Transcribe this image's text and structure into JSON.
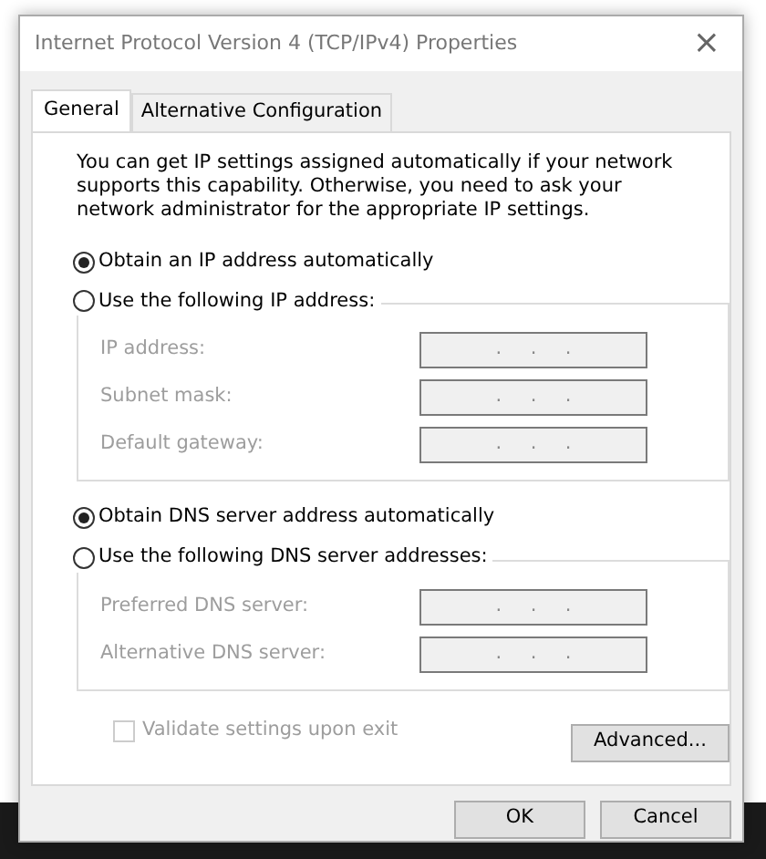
{
  "window": {
    "title": "Internet Protocol Version 4 (TCP/IPv4) Properties",
    "close": "×"
  },
  "tabs": [
    {
      "label": "General",
      "selected": true
    },
    {
      "label": "Alternative Configuration",
      "selected": false
    }
  ],
  "intro": "You can get IP settings assigned automatically if your network supports this capability. Otherwise, you need to ask your network administrator for the appropriate IP settings.",
  "groups": [
    {
      "auto_option": {
        "label": "Obtain an IP address automatically",
        "selected": true
      },
      "manual_option": {
        "label": "Use the following IP address:",
        "selected": false
      },
      "fields": [
        {
          "label": "IP address:",
          "separators": [
            ".",
            ".",
            "."
          ],
          "disabled": true
        },
        {
          "label": "Subnet mask:",
          "separators": [
            ".",
            ".",
            "."
          ],
          "disabled": true
        },
        {
          "label": "Default gateway:",
          "separators": [
            ".",
            ".",
            "."
          ],
          "disabled": true
        }
      ]
    },
    {
      "auto_option": {
        "label": "Obtain DNS server address automatically",
        "selected": true
      },
      "manual_option": {
        "label": "Use the following DNS server addresses:",
        "selected": false
      },
      "fields": [
        {
          "label": "Preferred DNS server:",
          "separators": [
            ".",
            ".",
            "."
          ],
          "disabled": true
        },
        {
          "label": "Alternative DNS server:",
          "separators": [
            ".",
            ".",
            "."
          ],
          "disabled": true
        }
      ]
    }
  ],
  "validate": {
    "label": "Validate settings upon exit",
    "checked": false,
    "disabled": true
  },
  "advanced_button": "Advanced...",
  "buttons": [
    "OK",
    "Cancel"
  ]
}
